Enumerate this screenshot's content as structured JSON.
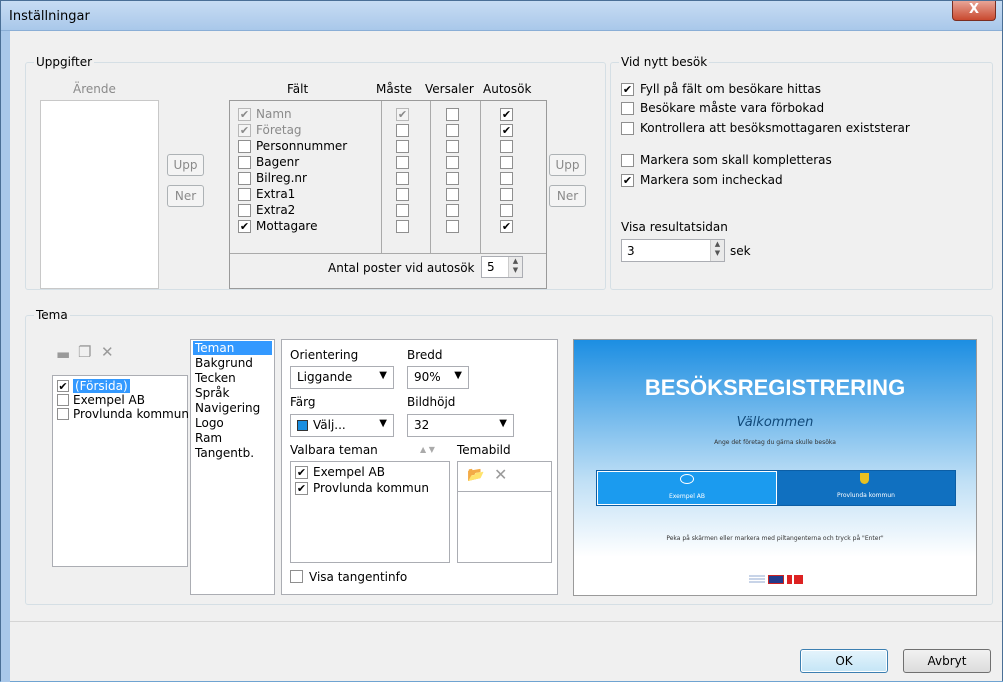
{
  "window": {
    "title": "Inställningar",
    "close": "X"
  },
  "uppgifter": {
    "legend": "Uppgifter",
    "arende_header": "Ärende",
    "up": "Upp",
    "down": "Ner",
    "headers": {
      "falt": "Fält",
      "maste": "Måste",
      "versaler": "Versaler",
      "autosok": "Autosök"
    },
    "fields": [
      {
        "label": "Namn",
        "checked": true,
        "disabled": true,
        "maste": true,
        "maste_dis": true,
        "versaler": false,
        "autosok": true
      },
      {
        "label": "Företag",
        "checked": true,
        "disabled": true,
        "maste": false,
        "maste_dis": false,
        "versaler": false,
        "autosok": true
      },
      {
        "label": "Personnummer",
        "checked": false,
        "disabled": false,
        "maste": false,
        "versaler": false,
        "autosok": false
      },
      {
        "label": "Bagenr",
        "checked": false,
        "disabled": false,
        "maste": false,
        "versaler": false,
        "autosok": false
      },
      {
        "label": "Bilreg.nr",
        "checked": false,
        "disabled": false,
        "maste": false,
        "versaler": false,
        "autosok": false
      },
      {
        "label": "Extra1",
        "checked": false,
        "disabled": false,
        "maste": false,
        "versaler": false,
        "autosok": false
      },
      {
        "label": "Extra2",
        "checked": false,
        "disabled": false,
        "maste": false,
        "versaler": false,
        "autosok": false
      },
      {
        "label": "Mottagare",
        "checked": true,
        "disabled": false,
        "maste": false,
        "versaler": false,
        "autosok": true
      }
    ],
    "antal_label": "Antal poster vid autosök",
    "antal_value": "5"
  },
  "nytt": {
    "legend": "Vid nytt besök",
    "options": [
      {
        "label": "Fyll på fält om besökare hittas",
        "checked": true
      },
      {
        "label": "Besökare måste vara förbokad",
        "checked": false
      },
      {
        "label": "Kontrollera att besöksmottagaren existsterar",
        "checked": false
      },
      {
        "label": "Markera som skall kompletteras",
        "checked": false
      },
      {
        "label": "Markera som incheckad",
        "checked": true
      }
    ],
    "resultat_label": "Visa resultatsidan",
    "resultat_value": "3",
    "resultat_unit": "sek"
  },
  "tema": {
    "legend": "Tema",
    "themes": [
      {
        "label": "(Försida)",
        "checked": true
      },
      {
        "label": "Exempel AB",
        "checked": false
      },
      {
        "label": "Provlunda kommun",
        "checked": false
      }
    ],
    "nav": [
      "Teman",
      "Bakgrund",
      "Tecken",
      "Språk",
      "Navigering",
      "Logo",
      "Ram",
      "Tangentb."
    ],
    "orientering_label": "Orientering",
    "orientering_value": "Liggande",
    "bredd_label": "Bredd",
    "bredd_value": "90%",
    "farg_label": "Färg",
    "farg_value": "Välj...",
    "farg_color": "#1a8ee0",
    "bildhojd_label": "Bildhöjd",
    "bildhojd_value": "32",
    "valbara_label": "Valbara teman",
    "valbara": [
      {
        "label": "Exempel AB",
        "checked": true
      },
      {
        "label": "Provlunda kommun",
        "checked": true
      }
    ],
    "temabild_label": "Temabild",
    "tangentinfo_label": "Visa tangentinfo",
    "tangentinfo_checked": false
  },
  "preview": {
    "title": "BESÖKSREGISTRERING",
    "welcome": "Välkommen",
    "instruction": "Ange det företag du gärna skulle besöka",
    "tab1": "Exempel AB",
    "tab2": "Provlunda kommun",
    "footer": "Peka på skärmen eller markera med piltangenterna och tryck på \"Enter\""
  },
  "footer": {
    "ok": "OK",
    "cancel": "Avbryt"
  }
}
